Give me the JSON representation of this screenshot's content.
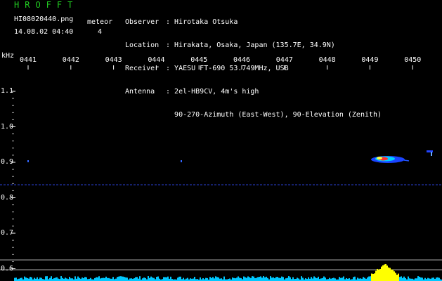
{
  "header": {
    "brand": "HROFFT",
    "filename": "HI08020440.png",
    "datetime": "14.08.02 04:40",
    "meteor_label": "meteor",
    "meteor_count": "4"
  },
  "info": {
    "observer_label": "Observer",
    "observer": "Hirotaka Otsuka",
    "location_label": "Location",
    "location": "Hirakata, Osaka, Japan (135.7E, 34.9N)",
    "receiver_label": "Receiver",
    "receiver": "YAESU FT-690 53.749MHz, USB",
    "antenna_label": "Antenna",
    "antenna_line1": "2el-HB9CV, 4m's high",
    "antenna_line2": "90-270-Azimuth (East-West), 90-Elevation (Zenith)"
  },
  "axis": {
    "freq_unit": "kHz",
    "time_ticks": [
      "0441",
      "0442",
      "0443",
      "0444",
      "0445",
      "0446",
      "0447",
      "0448",
      "0449",
      "0450"
    ],
    "freq_ticks": [
      "1.1",
      "1.0",
      "0.9",
      "0.8",
      "0.7",
      "0.6"
    ]
  },
  "colors": {
    "background": "#000000",
    "text": "#ffffff",
    "brand": "#22cc22",
    "noise_line": "#2233aa",
    "spectrum_low": "#00c8ff",
    "spectrum_peak": "#ffff00"
  }
}
